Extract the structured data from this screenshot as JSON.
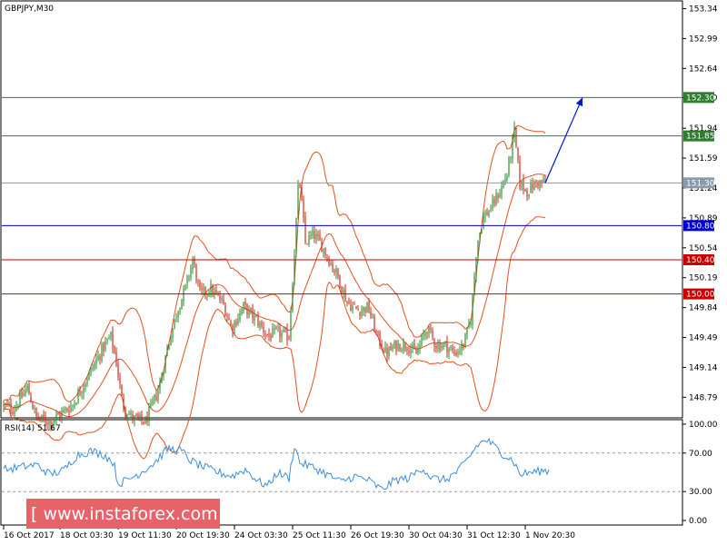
{
  "window": {
    "symbol_label": "GBPJPY,M30",
    "rsi_label": "RSI(14) 51.67"
  },
  "watermark": {
    "text": "[  www.instaforex.com ]",
    "bg_color": "#e8626a"
  },
  "colors": {
    "candle_up": "#2e8b2e",
    "candle_down": "#cc2a1a",
    "bollinger": "#e0521e",
    "rsi_line": "#3d8fd6",
    "support_red": "#cc0000",
    "pivot_blue": "#0000cc",
    "resistance_green": "#2f7d2f",
    "current_gray": "#8a9aa8",
    "arrow": "#0018cc"
  },
  "chart_data": [
    {
      "type": "candlestick",
      "title": "GBPJPY,M30",
      "y_ticks": [
        "153.34",
        "152.99",
        "152.64",
        "152.30",
        "151.94",
        "151.59",
        "151.24",
        "150.89",
        "150.54",
        "150.19",
        "149.84",
        "149.49",
        "149.14",
        "148.79"
      ],
      "ylim": [
        148.56,
        153.42
      ],
      "x_ticks": [
        "16 Oct 2017",
        "18 Oct 03:30",
        "19 Oct 11:30",
        "20 Oct 19:30",
        "24 Oct 03:30",
        "25 Oct 11:30",
        "26 Oct 19:30",
        "30 Oct 04:30",
        "31 Oct 12:30",
        "1 Nov 20:30"
      ],
      "levels": [
        {
          "value": 152.3,
          "label": "152.30",
          "role": "resistance"
        },
        {
          "value": 151.85,
          "label": "151.85",
          "role": "resistance"
        },
        {
          "value": 151.3,
          "label": "151.30",
          "role": "current"
        },
        {
          "value": 150.8,
          "label": "150.80",
          "role": "pivot"
        },
        {
          "value": 150.4,
          "label": "150.40",
          "role": "support"
        },
        {
          "value": 150.0,
          "label": "150.00",
          "role": "support"
        }
      ],
      "close_path": [
        [
          0,
          148.7
        ],
        [
          15,
          148.65
        ],
        [
          30,
          148.9
        ],
        [
          40,
          148.55
        ],
        [
          55,
          148.5
        ],
        [
          80,
          148.7
        ],
        [
          100,
          149.1
        ],
        [
          115,
          149.4
        ],
        [
          122,
          149.5
        ],
        [
          128,
          149.2
        ],
        [
          135,
          148.7
        ],
        [
          145,
          148.55
        ],
        [
          160,
          148.5
        ],
        [
          175,
          148.9
        ],
        [
          185,
          149.4
        ],
        [
          195,
          149.8
        ],
        [
          205,
          150.1
        ],
        [
          212,
          150.4
        ],
        [
          220,
          150.0
        ],
        [
          232,
          150.05
        ],
        [
          245,
          149.9
        ],
        [
          255,
          149.6
        ],
        [
          268,
          149.85
        ],
        [
          282,
          149.7
        ],
        [
          295,
          149.5
        ],
        [
          305,
          149.55
        ],
        [
          318,
          149.5
        ],
        [
          324,
          150.5
        ],
        [
          329,
          151.4
        ],
        [
          336,
          150.6
        ],
        [
          345,
          150.7
        ],
        [
          352,
          150.6
        ],
        [
          362,
          150.4
        ],
        [
          372,
          150.2
        ],
        [
          382,
          149.9
        ],
        [
          395,
          149.8
        ],
        [
          405,
          149.85
        ],
        [
          415,
          149.5
        ],
        [
          425,
          149.3
        ],
        [
          436,
          149.4
        ],
        [
          448,
          149.4
        ],
        [
          458,
          149.3
        ],
        [
          470,
          149.6
        ],
        [
          480,
          149.4
        ],
        [
          490,
          149.4
        ],
        [
          500,
          149.3
        ],
        [
          510,
          149.4
        ],
        [
          518,
          149.7
        ],
        [
          525,
          150.6
        ],
        [
          532,
          150.9
        ],
        [
          540,
          151.0
        ],
        [
          550,
          151.2
        ],
        [
          558,
          151.4
        ],
        [
          566,
          151.9
        ],
        [
          572,
          151.3
        ],
        [
          580,
          151.2
        ],
        [
          590,
          151.3
        ],
        [
          600,
          151.3
        ]
      ],
      "arrow": {
        "from": [
          600,
          151.3
        ],
        "to": [
          641,
          152.3
        ]
      }
    },
    {
      "type": "line",
      "title": "RSI(14) 51.67",
      "y_ticks": [
        "100.00",
        "70.00",
        "30.00",
        "0.00"
      ],
      "ylim": [
        0,
        100
      ],
      "guide_levels": [
        70,
        30
      ],
      "series": [
        {
          "values_path": [
            [
              0,
              52
            ],
            [
              20,
              55
            ],
            [
              40,
              58
            ],
            [
              55,
              48
            ],
            [
              70,
              52
            ],
            [
              85,
              68
            ],
            [
              100,
              72
            ],
            [
              115,
              68
            ],
            [
              125,
              60
            ],
            [
              130,
              38
            ],
            [
              140,
              42
            ],
            [
              155,
              50
            ],
            [
              170,
              60
            ],
            [
              185,
              75
            ],
            [
              200,
              72
            ],
            [
              210,
              62
            ],
            [
              225,
              55
            ],
            [
              240,
              50
            ],
            [
              255,
              46
            ],
            [
              270,
              53
            ],
            [
              285,
              40
            ],
            [
              295,
              36
            ],
            [
              305,
              50
            ],
            [
              318,
              44
            ],
            [
              324,
              78
            ],
            [
              330,
              60
            ],
            [
              345,
              55
            ],
            [
              360,
              48
            ],
            [
              375,
              40
            ],
            [
              390,
              46
            ],
            [
              405,
              42
            ],
            [
              420,
              32
            ],
            [
              435,
              42
            ],
            [
              450,
              44
            ],
            [
              465,
              55
            ],
            [
              475,
              44
            ],
            [
              490,
              42
            ],
            [
              505,
              52
            ],
            [
              515,
              64
            ],
            [
              525,
              78
            ],
            [
              535,
              84
            ],
            [
              545,
              76
            ],
            [
              555,
              68
            ],
            [
              565,
              62
            ],
            [
              572,
              48
            ],
            [
              585,
              50
            ],
            [
              600,
              52
            ],
            [
              604,
              51.67
            ]
          ]
        }
      ]
    }
  ]
}
